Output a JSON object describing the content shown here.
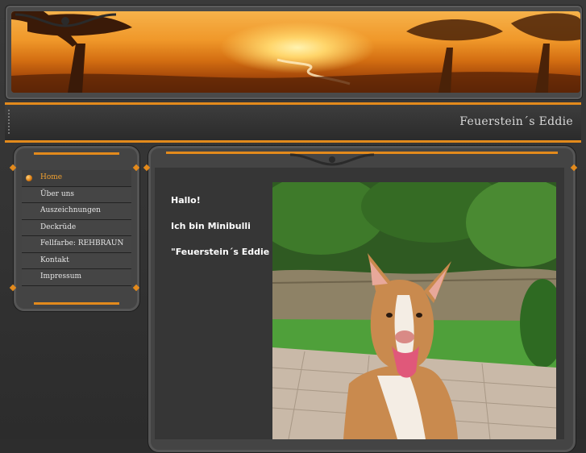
{
  "site": {
    "title": "Feuerstein´s Eddie"
  },
  "nav": {
    "items": [
      {
        "label": "Home",
        "active": true
      },
      {
        "label": "Über uns",
        "active": false
      },
      {
        "label": "Auszeichnungen",
        "active": false
      },
      {
        "label": "Deckrüde",
        "active": false
      },
      {
        "label": "Fellfarbe: REHBRAUN",
        "active": false
      },
      {
        "label": "Kontakt",
        "active": false
      },
      {
        "label": "Impressum",
        "active": false
      }
    ]
  },
  "main": {
    "greeting": "Hallo!",
    "intro": "Ich bin Minibulli",
    "name": "\"Feuerstein´s Eddie \""
  },
  "colors": {
    "accent": "#e38a1c",
    "active_nav": "#f0a030",
    "text": "#ffffff"
  }
}
